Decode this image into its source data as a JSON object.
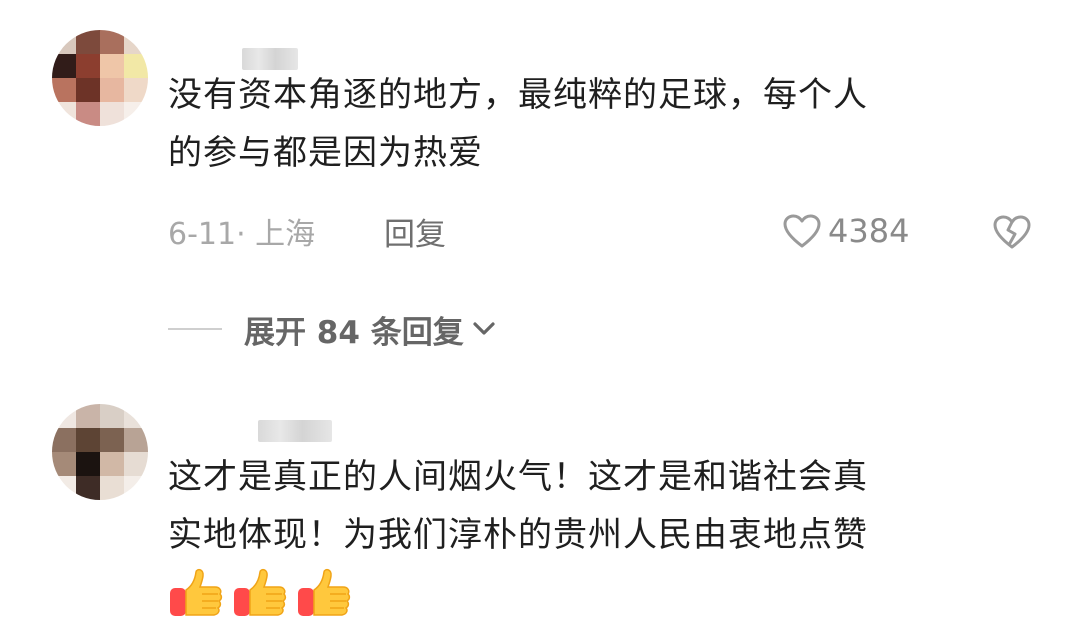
{
  "comments": [
    {
      "text": "没有资本角逐的地方，最纯粹的足球，每个人的参与都是因为热爱",
      "line1": "没有资本角逐的地方，最纯粹的足球，每个人",
      "line2": "的参与都是因为热爱",
      "date_location": "6-11· 上海",
      "reply_label": "回复",
      "like_count": "4384",
      "expand_replies_label": "展开 84 条回复"
    },
    {
      "line1": "这才是真正的人间烟火气！这才是和谐社会真",
      "line2": "实地体现！为我们淳朴的贵州人民由衷地点赞",
      "emoji_count": 3,
      "emoji_icon": "thumbs-up-emoji"
    }
  ],
  "colors": {
    "text": "#1f1f1f",
    "meta": "#a8a8a8",
    "reply": "#6f6f6f",
    "expand": "#666666"
  },
  "icons": {
    "like": "heart-outline-icon",
    "dislike": "broken-heart-icon",
    "expand": "chevron-down-icon"
  }
}
